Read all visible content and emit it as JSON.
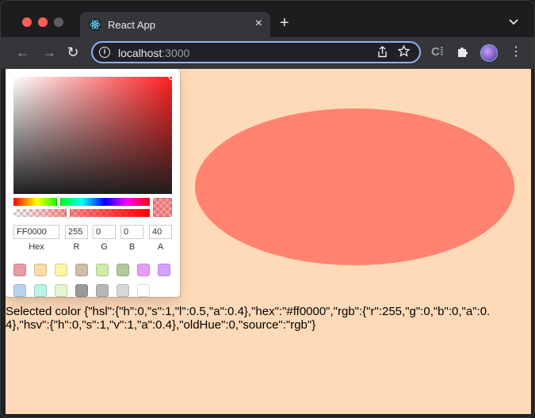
{
  "browser": {
    "tab_title": "React App",
    "tab_close": "×",
    "new_tab": "+",
    "tab_menu": "⌄",
    "url_host": "localhost",
    "url_port": ":3000",
    "nav": {
      "back": "←",
      "forward": "→",
      "reload": "↻"
    },
    "icons": [
      "react-favicon-icon",
      "info-icon",
      "share-icon",
      "star-icon",
      "extension-icon",
      "puzzle-icon",
      "profile-avatar",
      "kebab-menu-icon"
    ]
  },
  "picker": {
    "hue_position": 0.33,
    "alpha": 0.4,
    "saturation_cursor": {
      "s": 1,
      "v": 1
    },
    "fields": {
      "hex": {
        "value": "FF0000",
        "label": "Hex"
      },
      "r": {
        "value": "255",
        "label": "R"
      },
      "g": {
        "value": "0",
        "label": "G"
      },
      "b": {
        "value": "0",
        "label": "B"
      },
      "a": {
        "value": "40",
        "label": "A"
      }
    },
    "preset_colors": [
      "#D0021B",
      "#F5A623",
      "#F8E71C",
      "#8B572A",
      "#7ED321",
      "#417505",
      "#BD10E0",
      "#9013FE",
      "#4A90E2",
      "#50E3C2",
      "#B8E986",
      "#000000",
      "#4A4A4A",
      "#9B9B9B",
      "#FFFFFF"
    ],
    "preset_display_alpha": 0.4
  },
  "shape": {
    "type": "ellipse",
    "fill": "#ff0000",
    "opacity": 0.4
  },
  "colors": {
    "page_bg": "#ffdab9",
    "chrome_bg": "#35363a",
    "accent": "#8ab4f8"
  },
  "selected_text": "Selected color {\"hsl\":{\"h\":0,\"s\":1,\"l\":0.5,\"a\":0.4},\"hex\":\"#ff0000\",\"rgb\":{\"r\":255,\"g\":0,\"b\":0,\"a\":0.4},\"hsv\":{\"h\":0,\"s\":1,\"v\":1,\"a\":0.4},\"oldHue\":0,\"source\":\"rgb\"}"
}
